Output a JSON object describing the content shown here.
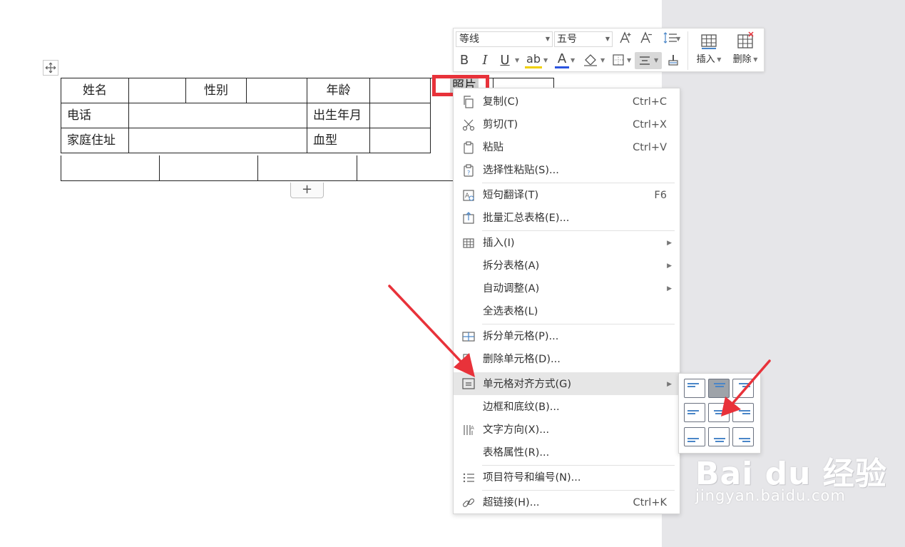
{
  "table": {
    "row1": [
      "姓名",
      "",
      "性别",
      "",
      "年龄",
      ""
    ],
    "row2": [
      "电话",
      "",
      "出生年月",
      ""
    ],
    "row3": [
      "家庭住址",
      "",
      "血型",
      ""
    ],
    "photo": "照片",
    "add_row": "+"
  },
  "toolbar": {
    "font_name": "等线",
    "font_size": "五号",
    "bold": "B",
    "italic": "I",
    "underline": "U",
    "highlight": "ab",
    "font_color": "A",
    "insert_label": "插入",
    "delete_label": "删除"
  },
  "context_menu": {
    "items": [
      {
        "label": "复制(C)",
        "shortcut": "Ctrl+C",
        "icon": "copy-icon"
      },
      {
        "label": "剪切(T)",
        "shortcut": "Ctrl+X",
        "icon": "scissors-icon"
      },
      {
        "label": "粘贴",
        "shortcut": "Ctrl+V",
        "icon": "paste-icon"
      },
      {
        "label": "选择性粘贴(S)...",
        "shortcut": "",
        "icon": "paste-special-icon"
      },
      {
        "label": "短句翻译(T)",
        "shortcut": "F6",
        "icon": "translate-icon"
      },
      {
        "label": "批量汇总表格(E)...",
        "shortcut": "",
        "icon": "batch-summary-icon"
      },
      {
        "label": "插入(I)",
        "shortcut": "",
        "icon": "table-insert-icon"
      },
      {
        "label": "拆分表格(A)",
        "shortcut": "",
        "icon": ""
      },
      {
        "label": "自动调整(A)",
        "shortcut": "",
        "icon": ""
      },
      {
        "label": "全选表格(L)",
        "shortcut": "",
        "icon": ""
      },
      {
        "label": "拆分单元格(P)...",
        "shortcut": "",
        "icon": "split-cell-icon"
      },
      {
        "label": "删除单元格(D)...",
        "shortcut": "",
        "icon": "delete-cell-icon"
      },
      {
        "label": "单元格对齐方式(G)",
        "shortcut": "",
        "icon": "cell-align-icon"
      },
      {
        "label": "边框和底纹(B)...",
        "shortcut": "",
        "icon": ""
      },
      {
        "label": "文字方向(X)...",
        "shortcut": "",
        "icon": "text-direction-icon"
      },
      {
        "label": "表格属性(R)...",
        "shortcut": "",
        "icon": ""
      },
      {
        "label": "项目符号和编号(N)...",
        "shortcut": "",
        "icon": "bullet-list-icon"
      },
      {
        "label": "超链接(H)...",
        "shortcut": "Ctrl+K",
        "icon": "link-icon"
      }
    ]
  },
  "align_panel": {
    "selected": "top-center",
    "options": [
      "top-left",
      "top-center",
      "top-right",
      "middle-left",
      "middle-center",
      "middle-right",
      "bottom-left",
      "bottom-center",
      "bottom-right"
    ]
  },
  "watermark": {
    "brand": "Bai du 经验",
    "url": "jingyan.baidu.com"
  },
  "colors": {
    "highlight_red": "#e8323a",
    "menu_hover": "#e6e6e6",
    "side_gray": "#e6e6e9",
    "align_blue": "#4a86c8"
  }
}
